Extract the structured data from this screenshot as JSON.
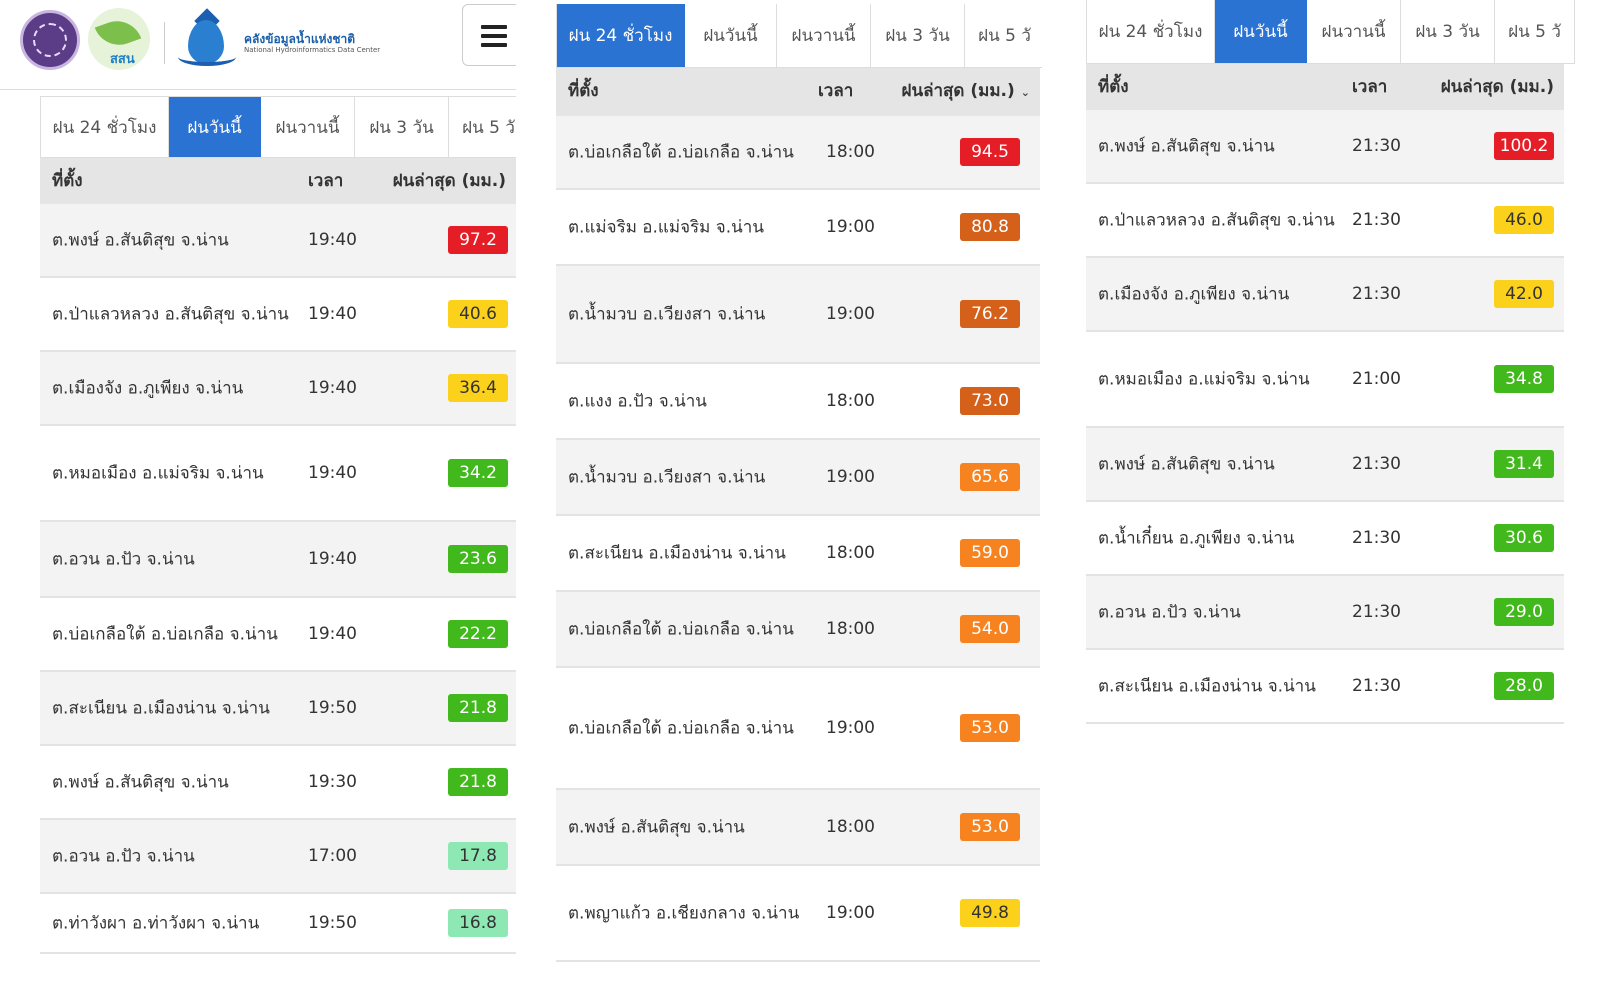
{
  "header": {
    "brand_thai": "คลังข้อมูลน้ำแห่งชาติ",
    "brand_english": "National Hydroinformatics Data Center",
    "partner_logo_text": "สสน"
  },
  "tabs": [
    "ฝน 24 ชั่วโมง",
    "ฝนวันนี้",
    "ฝนวานนี้",
    "ฝน 3 วัน",
    "ฝน 5 วั"
  ],
  "columns": {
    "location": "ที่ตั้ง",
    "time": "เวลา",
    "rain": "ฝนล่าสุด (มม.)"
  },
  "colors": {
    "accent": "#2b73d2",
    "red": "#e41d27",
    "dark_orange": "#d4601a",
    "orange": "#f6831f",
    "yellow": "#fbd11b",
    "green": "#41b81c",
    "light_green": "#8ee8b3"
  },
  "panels": [
    {
      "active_tab": 1,
      "rows": [
        {
          "location": "ต.พงษ์ อ.สันติสุข จ.น่าน",
          "time": "19:40",
          "rain": "97.2",
          "level": "red"
        },
        {
          "location": "ต.ป่าแลวหลวง อ.สันติสุข จ.น่าน",
          "time": "19:40",
          "rain": "40.6",
          "level": "yellow"
        },
        {
          "location": "ต.เมืองจัง อ.ภูเพียง จ.น่าน",
          "time": "19:40",
          "rain": "36.4",
          "level": "yellow"
        },
        {
          "location": "ต.หมอเมือง อ.แม่จริม จ.น่าน",
          "time": "19:40",
          "rain": "34.2",
          "level": "green"
        },
        {
          "location": "ต.อวน อ.ปัว จ.น่าน",
          "time": "19:40",
          "rain": "23.6",
          "level": "green"
        },
        {
          "location": "ต.บ่อเกลือใต้ อ.บ่อเกลือ จ.น่าน",
          "time": "19:40",
          "rain": "22.2",
          "level": "green"
        },
        {
          "location": "ต.สะเนียน อ.เมืองน่าน จ.น่าน",
          "time": "19:50",
          "rain": "21.8",
          "level": "green"
        },
        {
          "location": "ต.พงษ์ อ.สันติสุข จ.น่าน",
          "time": "19:30",
          "rain": "21.8",
          "level": "green"
        },
        {
          "location": "ต.อวน อ.ปัว จ.น่าน",
          "time": "17:00",
          "rain": "17.8",
          "level": "lightgreen"
        },
        {
          "location": "ต.ท่าวังผา อ.ท่าวังผา จ.น่าน",
          "time": "19:50",
          "rain": "16.8",
          "level": "lightgreen"
        }
      ]
    },
    {
      "active_tab": 0,
      "rows": [
        {
          "location": "ต.บ่อเกลือใต้ อ.บ่อเกลือ จ.น่าน",
          "time": "18:00",
          "rain": "94.5",
          "level": "red"
        },
        {
          "location": "ต.แม่จริม อ.แม่จริม จ.น่าน",
          "time": "19:00",
          "rain": "80.8",
          "level": "darkorange"
        },
        {
          "location": "ต.น้ำมวบ อ.เวียงสา จ.น่าน",
          "time": "19:00",
          "rain": "76.2",
          "level": "darkorange"
        },
        {
          "location": "ต.แงง อ.ปัว จ.น่าน",
          "time": "18:00",
          "rain": "73.0",
          "level": "darkorange"
        },
        {
          "location": "ต.น้ำมวบ อ.เวียงสา จ.น่าน",
          "time": "19:00",
          "rain": "65.6",
          "level": "orange"
        },
        {
          "location": "ต.สะเนียน อ.เมืองน่าน จ.น่าน",
          "time": "18:00",
          "rain": "59.0",
          "level": "orange"
        },
        {
          "location": "ต.บ่อเกลือใต้ อ.บ่อเกลือ จ.น่าน",
          "time": "18:00",
          "rain": "54.0",
          "level": "orange"
        },
        {
          "location": "ต.บ่อเกลือใต้ อ.บ่อเกลือ จ.น่าน",
          "time": "19:00",
          "rain": "53.0",
          "level": "orange"
        },
        {
          "location": "ต.พงษ์ อ.สันติสุข จ.น่าน",
          "time": "18:00",
          "rain": "53.0",
          "level": "orange"
        },
        {
          "location": "ต.พญาแก้ว อ.เชียงกลาง จ.น่าน",
          "time": "19:00",
          "rain": "49.8",
          "level": "yellow"
        }
      ]
    },
    {
      "active_tab": 1,
      "rows": [
        {
          "location": "ต.พงษ์ อ.สันติสุข จ.น่าน",
          "time": "21:30",
          "rain": "100.2",
          "level": "red"
        },
        {
          "location": "ต.ป่าแลวหลวง อ.สันติสุข จ.น่าน",
          "time": "21:30",
          "rain": "46.0",
          "level": "yellow"
        },
        {
          "location": "ต.เมืองจัง อ.ภูเพียง จ.น่าน",
          "time": "21:30",
          "rain": "42.0",
          "level": "yellow"
        },
        {
          "location": "ต.หมอเมือง อ.แม่จริม จ.น่าน",
          "time": "21:00",
          "rain": "34.8",
          "level": "green"
        },
        {
          "location": "ต.พงษ์ อ.สันติสุข จ.น่าน",
          "time": "21:30",
          "rain": "31.4",
          "level": "green"
        },
        {
          "location": "ต.น้ำเกี๋ยน อ.ภูเพียง จ.น่าน",
          "time": "21:30",
          "rain": "30.6",
          "level": "green"
        },
        {
          "location": "ต.อวน อ.ปัว จ.น่าน",
          "time": "21:30",
          "rain": "29.0",
          "level": "green"
        },
        {
          "location": "ต.สะเนียน อ.เมืองน่าน จ.น่าน",
          "time": "21:30",
          "rain": "28.0",
          "level": "green"
        }
      ]
    }
  ]
}
